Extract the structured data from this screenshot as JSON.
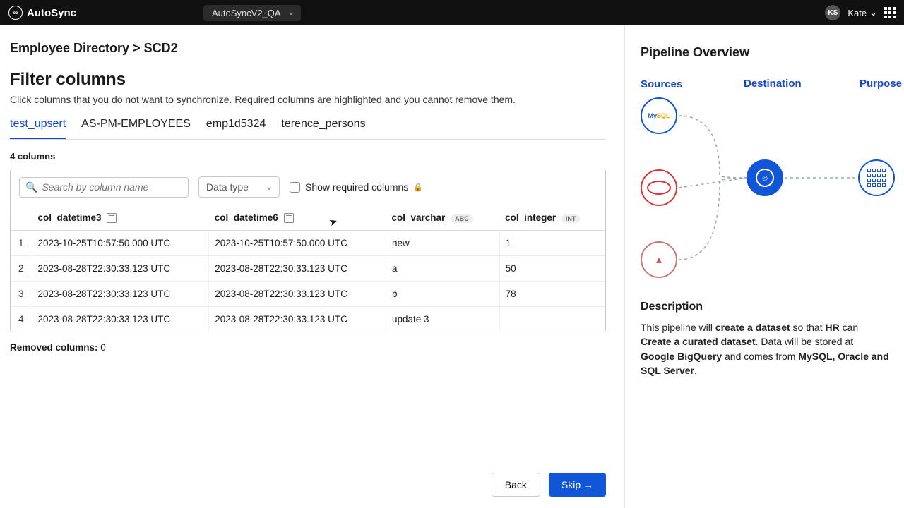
{
  "header": {
    "app_name": "AutoSync",
    "env": "AutoSyncV2_QA",
    "user_initials": "KS",
    "user_name": "Kate"
  },
  "breadcrumb": "Employee Directory > SCD2",
  "page": {
    "title": "Filter columns",
    "subtitle": "Click columns that you do not want to synchronize. Required columns are highlighted and you cannot remove them."
  },
  "tabs": [
    "test_upsert",
    "AS-PM-EMPLOYEES",
    "emp1d5324",
    "terence_persons"
  ],
  "active_tab": 0,
  "column_count_label": "4 columns",
  "search_placeholder": "Search by column name",
  "datatype_label": "Data type",
  "show_required_label": "Show required columns",
  "columns": [
    {
      "name": "col_datetime3",
      "type": "datetime"
    },
    {
      "name": "col_datetime6",
      "type": "datetime"
    },
    {
      "name": "col_varchar",
      "type": "ABC"
    },
    {
      "name": "col_integer",
      "type": "INT"
    }
  ],
  "rows": [
    {
      "n": "1",
      "c0": "2023-10-25T10:57:50.000 UTC",
      "c1": "2023-10-25T10:57:50.000 UTC",
      "c2": "new",
      "c3": "1"
    },
    {
      "n": "2",
      "c0": "2023-08-28T22:30:33.123 UTC",
      "c1": "2023-08-28T22:30:33.123 UTC",
      "c2": "a",
      "c3": "50"
    },
    {
      "n": "3",
      "c0": "2023-08-28T22:30:33.123 UTC",
      "c1": "2023-08-28T22:30:33.123 UTC",
      "c2": "b",
      "c3": "78"
    },
    {
      "n": "4",
      "c0": "2023-08-28T22:30:33.123 UTC",
      "c1": "2023-08-28T22:30:33.123 UTC",
      "c2": "update 3",
      "c3": ""
    }
  ],
  "removed_label": "Removed columns:",
  "removed_count": "0",
  "buttons": {
    "back": "Back",
    "skip": "Skip →"
  },
  "overview": {
    "title": "Pipeline Overview",
    "sources_label": "Sources",
    "destination_label": "Destination",
    "purpose_label": "Purpose",
    "source_nodes": [
      "MySQL",
      "Oracle",
      "SQLServer"
    ],
    "description_title": "Description",
    "desc_prefix": "This pipeline will ",
    "desc_b1": "create a dataset",
    "desc_mid1": " so that ",
    "desc_b2": "HR",
    "desc_mid2": " can ",
    "desc_b3": "Create a curated dataset",
    "desc_mid3": ". Data will be stored at ",
    "desc_b4": "Google BigQuery",
    "desc_mid4": " and comes from ",
    "desc_b5": "MySQL, Oracle and SQL Server",
    "desc_end": "."
  }
}
